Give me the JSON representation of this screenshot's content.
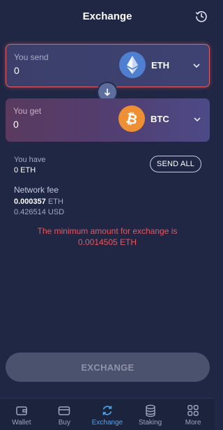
{
  "header": {
    "title": "Exchange",
    "history_icon": "history-icon"
  },
  "send": {
    "label": "You send",
    "amount": "0",
    "coin": "ETH",
    "coin_icon": "ethereum-icon"
  },
  "get": {
    "label": "You get",
    "amount": "0",
    "coin": "BTC",
    "coin_icon": "bitcoin-icon"
  },
  "swap": {
    "icon": "arrow-down-icon"
  },
  "balance": {
    "label": "You have",
    "value": "0 ETH",
    "send_all_label": "SEND ALL"
  },
  "fee": {
    "label": "Network fee",
    "amount": "0.000357",
    "amount_unit": "ETH",
    "fiat": "0.426514 USD"
  },
  "error": {
    "line1": "The minimum amount for exchange is",
    "line2": "0.0014505 ETH"
  },
  "action": {
    "exchange_label": "EXCHANGE"
  },
  "nav": {
    "items": [
      {
        "label": "Wallet",
        "icon": "wallet-icon",
        "active": false
      },
      {
        "label": "Buy",
        "icon": "card-icon",
        "active": false
      },
      {
        "label": "Exchange",
        "icon": "exchange-icon",
        "active": true
      },
      {
        "label": "Staking",
        "icon": "staking-icon",
        "active": false
      },
      {
        "label": "More",
        "icon": "more-icon",
        "active": false
      }
    ]
  },
  "colors": {
    "background": "#1f2744",
    "accent": "#4da6f0",
    "error": "#e8565f",
    "eth": "#4f7fd1",
    "btc": "#ef8f33"
  }
}
